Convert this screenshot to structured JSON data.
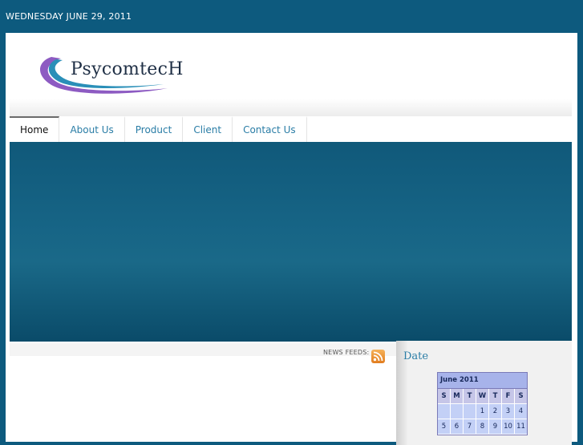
{
  "top_date": "WEDNESDAY JUNE 29, 2011",
  "logo": {
    "text": "PsycomtecH"
  },
  "nav": {
    "items": [
      {
        "label": "Home",
        "active": true
      },
      {
        "label": "About Us",
        "active": false
      },
      {
        "label": "Product",
        "active": false
      },
      {
        "label": "Client",
        "active": false
      },
      {
        "label": "Contact Us",
        "active": false
      }
    ]
  },
  "feeds_label": "NEWS FEEDS:",
  "sidebar": {
    "heading": "Date",
    "calendar": {
      "title": "June 2011",
      "day_names": [
        "S",
        "M",
        "T",
        "W",
        "T",
        "F",
        "S"
      ],
      "week1": [
        "",
        "",
        "",
        "1",
        "2",
        "3",
        "4"
      ],
      "week2": [
        "5",
        "6",
        "7",
        "8",
        "9",
        "10",
        "11"
      ]
    }
  },
  "colors": {
    "page_bg": "#0d5a7e",
    "link": "#2a7da6",
    "banner": "#176586",
    "calendar_header": "#a7b3ea"
  },
  "icons": {
    "rss": "rss-icon"
  }
}
